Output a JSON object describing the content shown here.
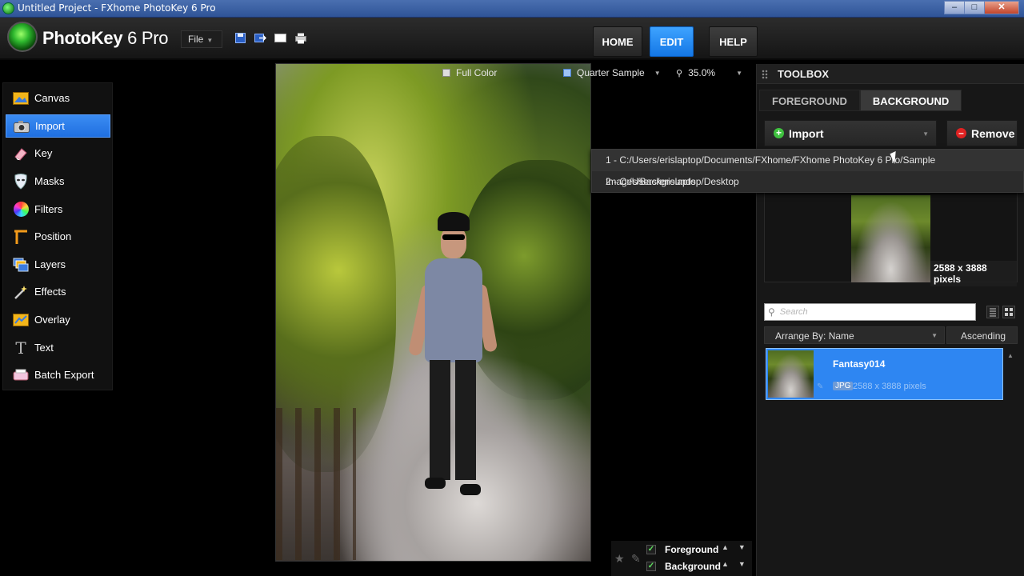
{
  "window": {
    "title": "Untitled Project - FXhome PhotoKey 6 Pro",
    "controls": [
      "minimize",
      "maximize",
      "close"
    ]
  },
  "header": {
    "logo_name": "PhotoKey",
    "logo_version": "6 Pro",
    "file_menu": "File",
    "toolbar_icons": [
      "save-icon",
      "export-icon",
      "screen-icon",
      "print-icon"
    ],
    "nav": [
      {
        "label": "HOME",
        "active": false
      },
      {
        "label": "EDIT",
        "active": true
      },
      {
        "label": "HELP",
        "active": false
      }
    ]
  },
  "sidebar": {
    "items": [
      {
        "label": "Canvas",
        "icon": "canvas-icon",
        "active": false
      },
      {
        "label": "Import",
        "icon": "camera-icon",
        "active": true
      },
      {
        "label": "Key",
        "icon": "eraser-icon",
        "active": false
      },
      {
        "label": "Masks",
        "icon": "mask-icon",
        "active": false
      },
      {
        "label": "Filters",
        "icon": "color-wheel-icon",
        "active": false
      },
      {
        "label": "Position",
        "icon": "position-icon",
        "active": false
      },
      {
        "label": "Layers",
        "icon": "layers-icon",
        "active": false
      },
      {
        "label": "Effects",
        "icon": "magic-wand-icon",
        "active": false
      },
      {
        "label": "Overlay",
        "icon": "overlay-icon",
        "active": false
      },
      {
        "label": "Text",
        "icon": "text-icon",
        "active": false
      },
      {
        "label": "Batch Export",
        "icon": "batch-export-icon",
        "active": false
      }
    ]
  },
  "viewbar": {
    "color_mode": "Full Color",
    "sample": "Quarter Sample",
    "zoom": "35.0%"
  },
  "layers": [
    {
      "label": "Foreground",
      "checked": true
    },
    {
      "label": "Background",
      "checked": true
    }
  ],
  "toolbox": {
    "title": "TOOLBOX",
    "tabs": [
      {
        "label": "FOREGROUND",
        "active": false
      },
      {
        "label": "BACKGROUND",
        "active": true
      }
    ],
    "import_label": "Import",
    "remove_label": "Remove",
    "preview_dims": "2588 x 3888 pixels",
    "search_placeholder": "Search",
    "arrange_label": "Arrange By: Name",
    "sort_order": "Ascending",
    "files": [
      {
        "name": "Fantasy014",
        "type": "JPG",
        "dims": "2588 x 3888 pixels",
        "selected": true
      }
    ]
  },
  "recent_dropdown": [
    "1 - C:/Users/erislaptop/Documents/FXhome/FXhome PhotoKey 6 Pro/Sample Images/Backgrounds",
    "2 - C:/Users/erislaptop/Desktop"
  ],
  "colors": {
    "accent": "#1f7ae8",
    "selected_item": "#2e86f2",
    "import_green": "#3fc23f",
    "remove_red": "#e02222"
  }
}
